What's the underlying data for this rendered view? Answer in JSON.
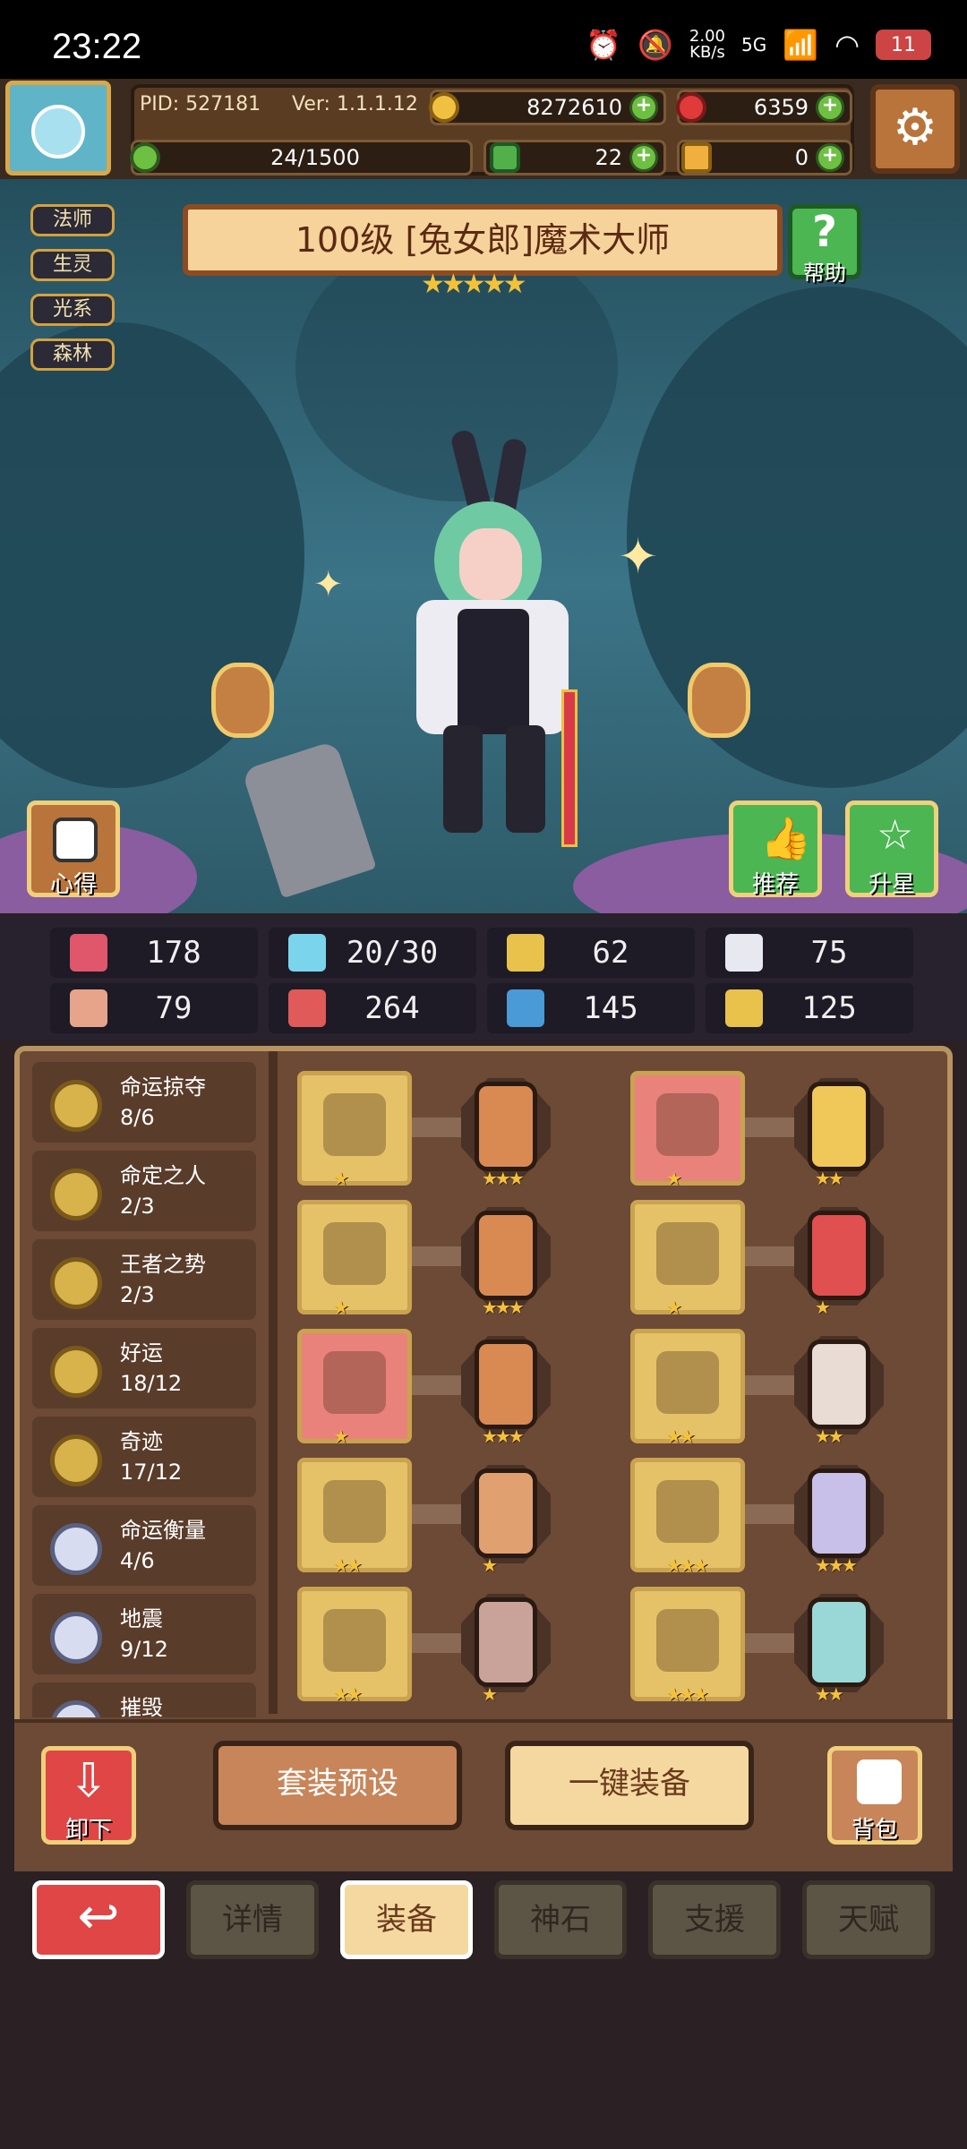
{
  "status_bar": {
    "time": "23:22",
    "speed_value": "2.00",
    "speed_unit": "KB/s",
    "network": "5G",
    "battery": "11"
  },
  "resources": {
    "pid": "PID: 527181",
    "version": "Ver: 1.1.1.12",
    "gold": "8272610",
    "ruby": "6359",
    "stamina": "24/1500",
    "clover": "22",
    "hammer": "0"
  },
  "hero": {
    "title": "100级 [兔女郎]魔术大师",
    "stars": "★★★★★",
    "tags": [
      "法师",
      "生灵",
      "光系",
      "森林"
    ],
    "help_label": "帮助",
    "notes_label": "心得",
    "recommend_label": "推荐",
    "upgrade_label": "升星"
  },
  "stats": [
    {
      "icon": "heart-icon",
      "value": "178",
      "color": "#e0566a"
    },
    {
      "icon": "mana-drop-icon",
      "value": "20/30",
      "color": "#7ad4ec"
    },
    {
      "icon": "shield-icon",
      "value": "62",
      "color": "#e8c24a"
    },
    {
      "icon": "wing-icon",
      "value": "75",
      "color": "#e8e8f0"
    },
    {
      "icon": "fist-icon",
      "value": "79",
      "color": "#e8a48a"
    },
    {
      "icon": "book-icon",
      "value": "264",
      "color": "#e05a5a"
    },
    {
      "icon": "boot-icon",
      "value": "145",
      "color": "#4a9ad8"
    },
    {
      "icon": "horseshoe-icon",
      "value": "125",
      "color": "#e8c24a"
    }
  ],
  "sets": [
    {
      "name": "命运掠夺",
      "count": "8/6",
      "tier": "gold"
    },
    {
      "name": "命定之人",
      "count": "2/3",
      "tier": "gold"
    },
    {
      "name": "王者之势",
      "count": "2/3",
      "tier": "gold"
    },
    {
      "name": "好运",
      "count": "18/12",
      "tier": "gold"
    },
    {
      "name": "奇迹",
      "count": "17/12",
      "tier": "gold"
    },
    {
      "name": "命运衡量",
      "count": "4/6",
      "tier": "silver"
    },
    {
      "name": "地震",
      "count": "9/12",
      "tier": "silver"
    },
    {
      "name": "摧毁",
      "count": "",
      "tier": "silver"
    }
  ],
  "equipment_left": [
    {
      "item": "axe-icon",
      "item_stars": "★",
      "gem_stars": "★★★",
      "gem_color": "#d98a52",
      "slot_color": "#e5c267"
    },
    {
      "item": "orb-icon",
      "item_stars": "★",
      "gem_stars": "★★★",
      "gem_color": "#d98a52",
      "slot_color": "#e5c267"
    },
    {
      "item": "amulet-icon",
      "item_stars": "★",
      "gem_stars": "★★★",
      "gem_color": "#d98a52",
      "slot_color": "#e9827a"
    },
    {
      "item": "jewel-icon",
      "item_stars": "★★",
      "gem_stars": "★",
      "gem_color": "#e0a070",
      "slot_color": "#e5c267"
    },
    {
      "item": "ring-icon",
      "item_stars": "★★",
      "gem_stars": "★",
      "gem_color": "#c9a39a",
      "slot_color": "#e5c267"
    }
  ],
  "equipment_right": [
    {
      "item": "hat-icon",
      "item_stars": "★",
      "gem_stars": "★★",
      "gem_color": "#f0c85a",
      "slot_color": "#e9827a"
    },
    {
      "item": "armor-icon",
      "item_stars": "★",
      "gem_stars": "★",
      "gem_color": "#e05050",
      "slot_color": "#e5c267"
    },
    {
      "item": "scepter-icon",
      "item_stars": "★★",
      "gem_stars": "★★",
      "gem_color": "#e8dcd4",
      "slot_color": "#e5c267"
    },
    {
      "item": "belt-icon",
      "item_stars": "★★★",
      "gem_stars": "★★★",
      "gem_color": "#c8c0e8",
      "slot_color": "#e5c267"
    },
    {
      "item": "boots-icon",
      "item_stars": "★★★",
      "gem_stars": "★★",
      "gem_color": "#9ad8d8",
      "slot_color": "#e5c267"
    }
  ],
  "actions": {
    "unequip": "卸下",
    "preset": "套装预设",
    "equip_all": "一键装备",
    "backpack": "背包"
  },
  "tabs": [
    {
      "label": "详情",
      "active": false
    },
    {
      "label": "装备",
      "active": true
    },
    {
      "label": "神石",
      "active": false
    },
    {
      "label": "支援",
      "active": false
    },
    {
      "label": "天赋",
      "active": false
    }
  ]
}
